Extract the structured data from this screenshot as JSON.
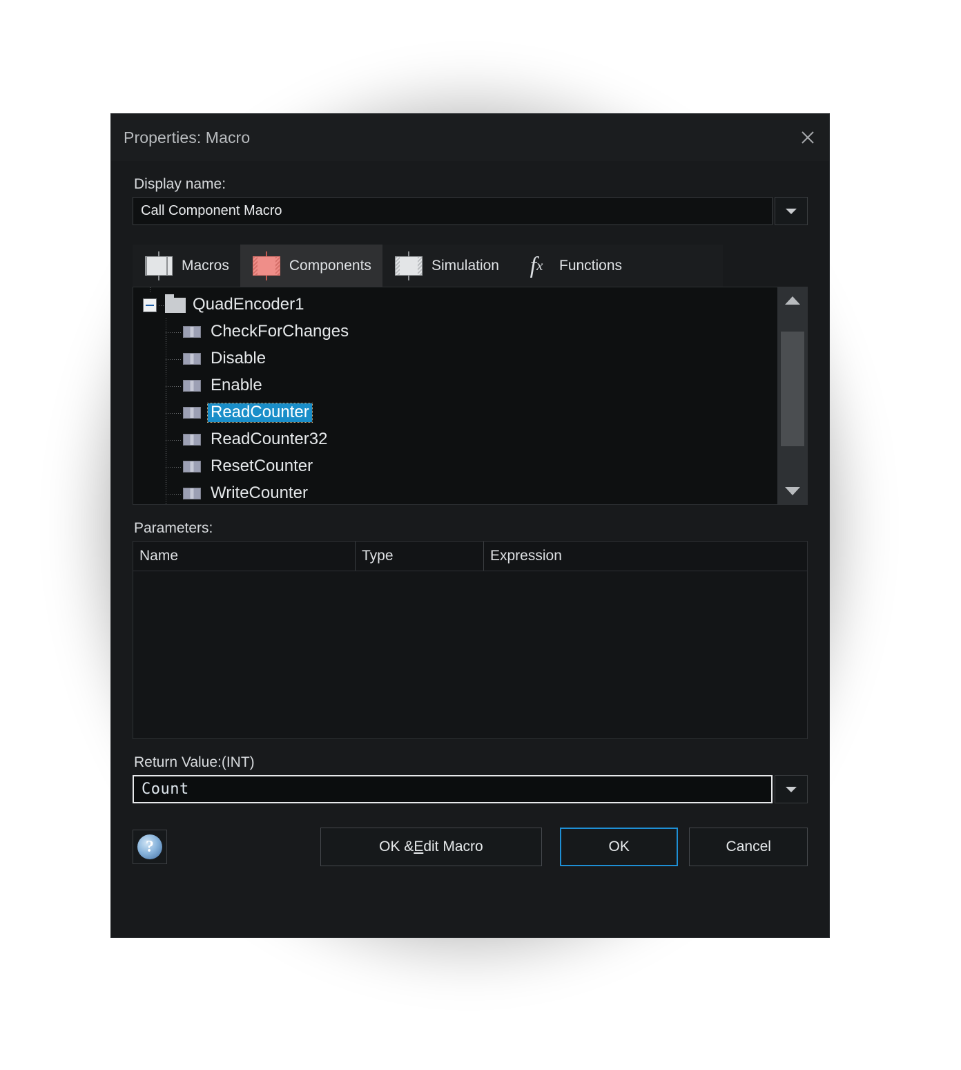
{
  "window": {
    "title": "Properties: Macro",
    "close_icon": "close-icon"
  },
  "display_name": {
    "label": "Display name:",
    "value": "Call Component Macro",
    "dropdown_icon": "chevron-down-icon"
  },
  "tabs": [
    {
      "label": "Macros",
      "icon": "component-chip-icon",
      "selected": false
    },
    {
      "label": "Components",
      "icon": "component-chip-red-icon",
      "selected": true
    },
    {
      "label": "Simulation",
      "icon": "component-chip-hatched-icon",
      "selected": false
    },
    {
      "label": "Functions",
      "icon": "fx-icon",
      "selected": false
    }
  ],
  "tree": {
    "root": {
      "label": "QuadEncoder1",
      "expander_icon": "minus-box-icon",
      "folder_icon": "folder-icon"
    },
    "items": [
      {
        "label": "CheckForChanges",
        "icon": "macro-block-icon",
        "selected": false
      },
      {
        "label": "Disable",
        "icon": "macro-block-icon",
        "selected": false
      },
      {
        "label": "Enable",
        "icon": "macro-block-icon",
        "selected": false
      },
      {
        "label": "ReadCounter",
        "icon": "macro-block-icon",
        "selected": true
      },
      {
        "label": "ReadCounter32",
        "icon": "macro-block-icon",
        "selected": false
      },
      {
        "label": "ResetCounter",
        "icon": "macro-block-icon",
        "selected": false
      },
      {
        "label": "WriteCounter",
        "icon": "macro-block-icon",
        "selected": false
      }
    ],
    "scrollbar": {
      "up_icon": "scroll-up-arrow-icon",
      "down_icon": "scroll-down-arrow-icon"
    }
  },
  "parameters": {
    "label": "Parameters:",
    "columns": [
      "Name",
      "Type",
      "Expression"
    ],
    "rows": []
  },
  "return_value": {
    "label": "Return Value:(INT)",
    "value": "Count",
    "dropdown_icon": "chevron-down-icon"
  },
  "footer": {
    "help_icon": "help-question-icon",
    "ok_edit_macro": "OK & Edit Macro",
    "ok_edit_macro_pre": "OK & ",
    "ok_edit_macro_key": "E",
    "ok_edit_macro_post": "dit Macro",
    "ok": "OK",
    "cancel": "Cancel"
  },
  "colors": {
    "dialog_bg": "#181a1c",
    "titlebar_bg": "#1b1d1f",
    "field_bg": "#0e1011",
    "selection_blue": "#1a8ec9",
    "accent_blue": "#1e8fd5",
    "component_red": "#ef8e89",
    "text": "#e8eaec"
  }
}
